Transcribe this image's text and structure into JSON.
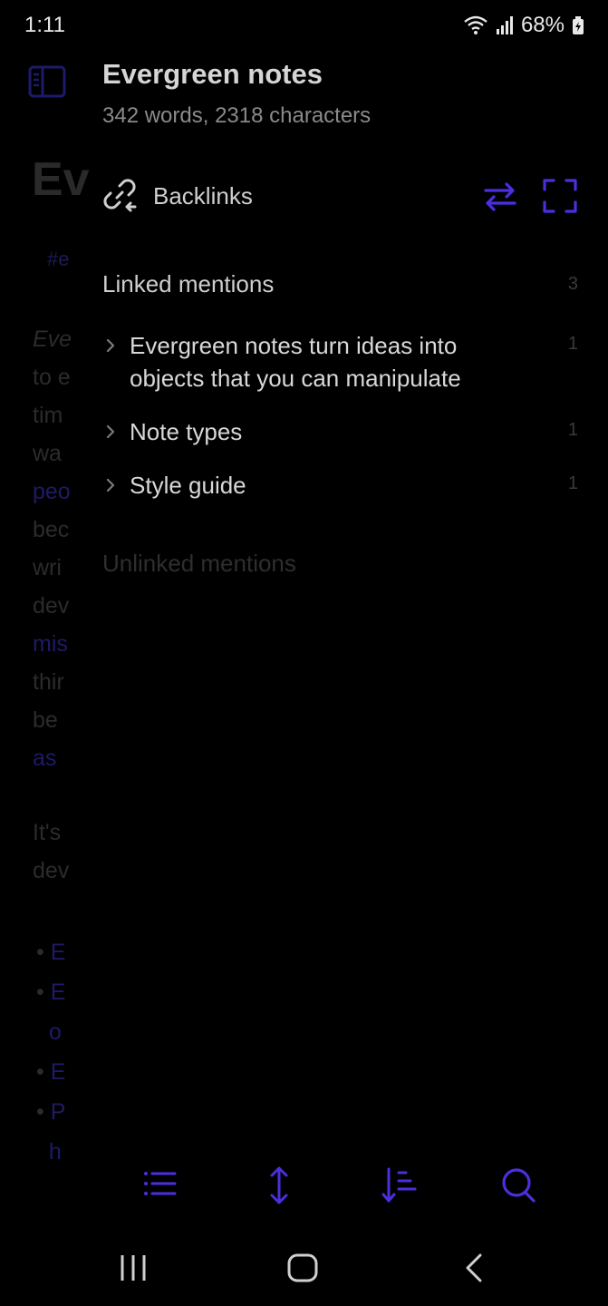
{
  "status": {
    "time": "1:11",
    "battery": "68%"
  },
  "editor": {
    "title_fragment": "Ev",
    "tag_fragment": "#e",
    "lines": [
      "Eve",
      "to e",
      "tim",
      "wa",
      "peo",
      "bec",
      "wri",
      "dev",
      "mis",
      "thir",
      "be ",
      "as "
    ],
    "para2": [
      "It's",
      "dev"
    ],
    "bullets": [
      "E",
      "E",
      "o",
      "E",
      "P",
      "h"
    ]
  },
  "note": {
    "title": "Evergreen notes",
    "stats": "342 words, 2318 characters"
  },
  "backlinks": {
    "label": "Backlinks",
    "linked": {
      "title": "Linked mentions",
      "count": "3",
      "items": [
        {
          "label": "Evergreen notes turn ideas into objects that you can manipulate",
          "count": "1"
        },
        {
          "label": "Note types",
          "count": "1"
        },
        {
          "label": "Style guide",
          "count": "1"
        }
      ]
    },
    "unlinked_title": "Unlinked mentions"
  },
  "colors": {
    "accent": "#4a2fe0",
    "background": "#000000"
  }
}
